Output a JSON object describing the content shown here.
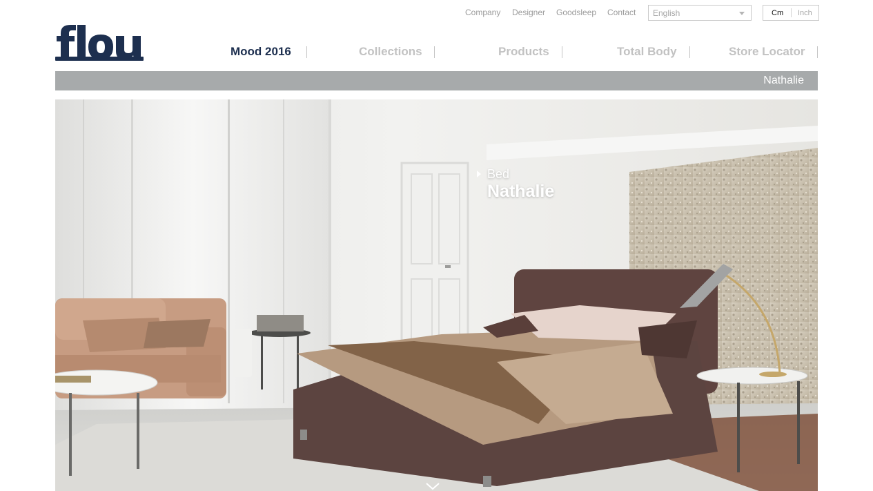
{
  "utility": {
    "links": [
      "Company",
      "Designer",
      "Goodsleep",
      "Contact"
    ],
    "language": "English",
    "units": [
      "Cm",
      "Inch"
    ]
  },
  "brand": {
    "name": "Flou"
  },
  "nav": {
    "items": [
      "Mood 2016",
      "Collections",
      "Products",
      "Total Body",
      "Store Locator"
    ]
  },
  "breadcrumb": {
    "text": "Nathalie"
  },
  "hero": {
    "category": "Bed",
    "product": "Nathalie"
  },
  "colors": {
    "brand": "#1d2f4f",
    "nav_inactive": "#c2c2c2",
    "breadcrumb_bg": "#a7aaab"
  }
}
